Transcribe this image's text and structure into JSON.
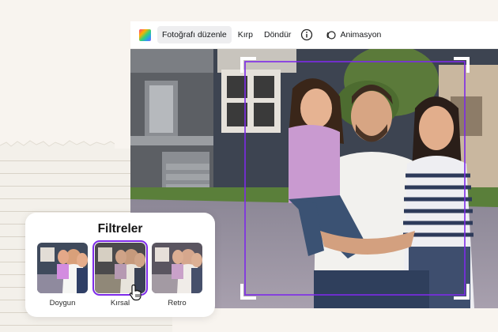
{
  "toolbar": {
    "items": [
      {
        "label": "Fotoğrafı düzenle",
        "active": true
      },
      {
        "label": "Kırp",
        "active": false
      },
      {
        "label": "Döndür",
        "active": false
      }
    ],
    "animation_label": "Animasyon"
  },
  "filters": {
    "title": "Filtreler",
    "items": [
      {
        "label": "Doygun",
        "selected": false
      },
      {
        "label": "Kırsal",
        "selected": true
      },
      {
        "label": "Retro",
        "selected": false
      }
    ]
  },
  "colors": {
    "accent": "#7d2ae8",
    "crop_frame": "#7d2ae8",
    "panel_bg": "#ffffff",
    "page_bg": "#f8f4ef"
  },
  "icons": {
    "color_tile": "color-palette-icon",
    "info": "info-icon",
    "animation": "animation-icon",
    "cursor": "hand-pointer-icon"
  }
}
